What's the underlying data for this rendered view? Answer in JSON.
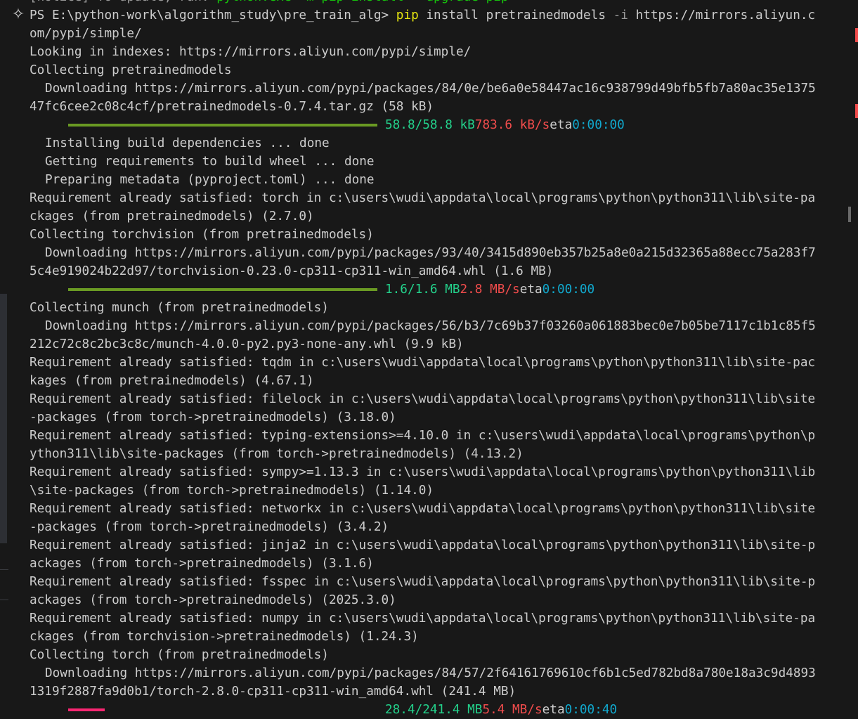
{
  "terminal": {
    "lines": [
      {
        "id": "notice",
        "kind": "notice",
        "parts": [
          {
            "t": "[notice]",
            "c": "gray"
          },
          {
            "t": " To update, run: ",
            "c": "gray"
          },
          {
            "t": "python.exe -m pip install --upgrade pip",
            "c": "pl-green"
          }
        ]
      },
      {
        "id": "cmd",
        "kind": "command",
        "parts": [
          {
            "t": "PS E:\\python-work\\algorithm_study\\pre_train_alg> ",
            "c": ""
          },
          {
            "t": "pip",
            "c": "yellow"
          },
          {
            "t": " install pretrainedmodels ",
            "c": ""
          },
          {
            "t": "-i",
            "c": "gray"
          },
          {
            "t": " https://mirrors.aliyun.c",
            "c": ""
          }
        ]
      },
      {
        "id": "cmd-wrap",
        "kind": "text",
        "parts": [
          {
            "t": "om/pypi/simple/",
            "c": ""
          }
        ]
      },
      {
        "id": "l1",
        "kind": "text",
        "parts": [
          {
            "t": "Looking in indexes: https://mirrors.aliyun.com/pypi/simple/",
            "c": ""
          }
        ]
      },
      {
        "id": "l2",
        "kind": "text",
        "parts": [
          {
            "t": "Collecting pretrainedmodels",
            "c": ""
          }
        ]
      },
      {
        "id": "l3",
        "kind": "text",
        "indent": true,
        "parts": [
          {
            "t": "Downloading https://mirrors.aliyun.com/pypi/packages/84/0e/be6a0e58447ac16c938799d49bfb5fb7a80ac35e1375",
            "c": ""
          }
        ]
      },
      {
        "id": "l4",
        "kind": "text",
        "parts": [
          {
            "t": "47fc6cee2c08c4cf/pretrainedmodels-0.7.4.tar.gz (58 kB)",
            "c": ""
          }
        ]
      },
      {
        "id": "p1",
        "kind": "progress",
        "fill": 1.0,
        "bar": "green",
        "size": "58.8/58.8 kB",
        "speed": "783.6 kB/s",
        "eta_label": "eta",
        "eta": "0:00:00"
      },
      {
        "id": "l5",
        "kind": "text",
        "indent": true,
        "parts": [
          {
            "t": "Installing build dependencies ... done",
            "c": ""
          }
        ]
      },
      {
        "id": "l6",
        "kind": "text",
        "indent": true,
        "parts": [
          {
            "t": "Getting requirements to build wheel ... done",
            "c": ""
          }
        ]
      },
      {
        "id": "l7",
        "kind": "text",
        "indent": true,
        "parts": [
          {
            "t": "Preparing metadata (pyproject.toml) ... done",
            "c": ""
          }
        ]
      },
      {
        "id": "l8",
        "kind": "text",
        "parts": [
          {
            "t": "Requirement already satisfied: torch in c:\\users\\wudi\\appdata\\local\\programs\\python\\python311\\lib\\site-pa",
            "c": ""
          }
        ]
      },
      {
        "id": "l9",
        "kind": "text",
        "parts": [
          {
            "t": "ckages (from pretrainedmodels) (2.7.0)",
            "c": ""
          }
        ]
      },
      {
        "id": "l10",
        "kind": "text",
        "parts": [
          {
            "t": "Collecting torchvision (from pretrainedmodels)",
            "c": ""
          }
        ]
      },
      {
        "id": "l11",
        "kind": "text",
        "indent": true,
        "parts": [
          {
            "t": "Downloading https://mirrors.aliyun.com/pypi/packages/93/40/3415d890eb357b25a8e0a215d32365a88ecc75a283f7",
            "c": ""
          }
        ]
      },
      {
        "id": "l12",
        "kind": "text",
        "parts": [
          {
            "t": "5c4e919024b22d97/torchvision-0.23.0-cp311-cp311-win_amd64.whl (1.6 MB)",
            "c": ""
          }
        ]
      },
      {
        "id": "p2",
        "kind": "progress",
        "fill": 1.0,
        "bar": "green",
        "size": "1.6/1.6 MB",
        "speed": "2.8 MB/s",
        "eta_label": "eta",
        "eta": "0:00:00"
      },
      {
        "id": "l13",
        "kind": "text",
        "parts": [
          {
            "t": "Collecting munch (from pretrainedmodels)",
            "c": ""
          }
        ]
      },
      {
        "id": "l14",
        "kind": "text",
        "indent": true,
        "parts": [
          {
            "t": "Downloading https://mirrors.aliyun.com/pypi/packages/56/b3/7c69b37f03260a061883bec0e7b05be7117c1b1c85f5",
            "c": ""
          }
        ]
      },
      {
        "id": "l15",
        "kind": "text",
        "parts": [
          {
            "t": "212c72c8c2bc3c8c/munch-4.0.0-py2.py3-none-any.whl (9.9 kB)",
            "c": ""
          }
        ]
      },
      {
        "id": "l16",
        "kind": "text",
        "parts": [
          {
            "t": "Requirement already satisfied: tqdm in c:\\users\\wudi\\appdata\\local\\programs\\python\\python311\\lib\\site-pac",
            "c": ""
          }
        ]
      },
      {
        "id": "l17",
        "kind": "text",
        "parts": [
          {
            "t": "kages (from pretrainedmodels) (4.67.1)",
            "c": ""
          }
        ]
      },
      {
        "id": "l18",
        "kind": "text",
        "parts": [
          {
            "t": "Requirement already satisfied: filelock in c:\\users\\wudi\\appdata\\local\\programs\\python\\python311\\lib\\site",
            "c": ""
          }
        ]
      },
      {
        "id": "l19",
        "kind": "text",
        "parts": [
          {
            "t": "-packages (from torch->pretrainedmodels) (3.18.0)",
            "c": ""
          }
        ]
      },
      {
        "id": "l20",
        "kind": "text",
        "parts": [
          {
            "t": "Requirement already satisfied: typing-extensions>=4.10.0 in c:\\users\\wudi\\appdata\\local\\programs\\python\\p",
            "c": ""
          }
        ]
      },
      {
        "id": "l21",
        "kind": "text",
        "parts": [
          {
            "t": "ython311\\lib\\site-packages (from torch->pretrainedmodels) (4.13.2)",
            "c": ""
          }
        ]
      },
      {
        "id": "l22",
        "kind": "text",
        "parts": [
          {
            "t": "Requirement already satisfied: sympy>=1.13.3 in c:\\users\\wudi\\appdata\\local\\programs\\python\\python311\\lib",
            "c": ""
          }
        ]
      },
      {
        "id": "l23",
        "kind": "text",
        "parts": [
          {
            "t": "\\site-packages (from torch->pretrainedmodels) (1.14.0)",
            "c": ""
          }
        ]
      },
      {
        "id": "l24",
        "kind": "text",
        "parts": [
          {
            "t": "Requirement already satisfied: networkx in c:\\users\\wudi\\appdata\\local\\programs\\python\\python311\\lib\\site",
            "c": ""
          }
        ]
      },
      {
        "id": "l25",
        "kind": "text",
        "parts": [
          {
            "t": "-packages (from torch->pretrainedmodels) (3.4.2)",
            "c": ""
          }
        ]
      },
      {
        "id": "l26",
        "kind": "text",
        "parts": [
          {
            "t": "Requirement already satisfied: jinja2 in c:\\users\\wudi\\appdata\\local\\programs\\python\\python311\\lib\\site-p",
            "c": ""
          }
        ]
      },
      {
        "id": "l27",
        "kind": "text",
        "parts": [
          {
            "t": "ackages (from torch->pretrainedmodels) (3.1.6)",
            "c": ""
          }
        ]
      },
      {
        "id": "l28",
        "kind": "text",
        "parts": [
          {
            "t": "Requirement already satisfied: fsspec in c:\\users\\wudi\\appdata\\local\\programs\\python\\python311\\lib\\site-p",
            "c": ""
          }
        ]
      },
      {
        "id": "l29",
        "kind": "text",
        "parts": [
          {
            "t": "ackages (from torch->pretrainedmodels) (2025.3.0)",
            "c": ""
          }
        ]
      },
      {
        "id": "l30",
        "kind": "text",
        "parts": [
          {
            "t": "Requirement already satisfied: numpy in c:\\users\\wudi\\appdata\\local\\programs\\python\\python311\\lib\\site-pa",
            "c": ""
          }
        ]
      },
      {
        "id": "l31",
        "kind": "text",
        "parts": [
          {
            "t": "ckages (from torchvision->pretrainedmodels) (1.24.3)",
            "c": ""
          }
        ]
      },
      {
        "id": "l32",
        "kind": "text",
        "parts": [
          {
            "t": "Collecting torch (from pretrainedmodels)",
            "c": ""
          }
        ]
      },
      {
        "id": "l33",
        "kind": "text",
        "indent": true,
        "parts": [
          {
            "t": "Downloading https://mirrors.aliyun.com/pypi/packages/84/57/2f64161769610cf6b1c5ed782bd8a780e18a3c9d4893",
            "c": ""
          }
        ]
      },
      {
        "id": "l34",
        "kind": "text",
        "parts": [
          {
            "t": "1319f2887fa9d0b1/torch-2.8.0-cp311-cp311-win_amd64.whl (241.4 MB)",
            "c": ""
          }
        ]
      },
      {
        "id": "p3",
        "kind": "progress",
        "fill": 0.118,
        "bar": "pink",
        "size": "28.4/241.4 MB",
        "speed": "5.4 MB/s",
        "eta_label": "eta",
        "eta": "0:00:40"
      }
    ]
  },
  "colors": {
    "background": "#181818",
    "text": "#cccccc",
    "prompt_command": "#e5e510",
    "progress_done": "#6a9a23",
    "progress_active": "#f92672",
    "size_text": "#23d18b",
    "speed_text": "#f14c4c",
    "eta_text": "#11a8cd"
  },
  "icons": {
    "chat_sparkle": "sparkle-icon"
  }
}
